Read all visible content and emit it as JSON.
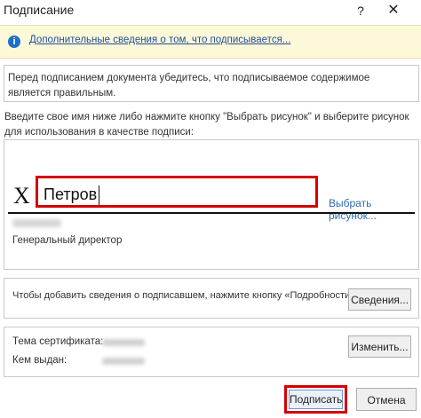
{
  "window": {
    "title": "Подписание",
    "help": "?",
    "close": "✕"
  },
  "infobar": {
    "icon": "i",
    "link": "Дополнительные сведения о том, что подписывается..."
  },
  "notice": "Перед подписанием документа убедитесь, что подписываемое содержимое является правильным.",
  "prompt": "Введите свое имя ниже либо нажмите кнопку \"Выбрать рисунок\" и выберите рисунок для использования в качестве подписи:",
  "signature": {
    "x_mark": "X",
    "name_value": "Петров",
    "pick_image": "Выбрать рисунок...",
    "signer_title": "Генеральный директор"
  },
  "details": {
    "text": "Чтобы добавить сведения о подписавшем, нажмите кнопку «Подробности».",
    "button": "Сведения..."
  },
  "certificate": {
    "subject_label": "Тема сертификата:",
    "issuer_label": "Кем выдан:",
    "change_button": "Изменить..."
  },
  "buttons": {
    "sign": "Подписать",
    "cancel": "Отмена"
  }
}
